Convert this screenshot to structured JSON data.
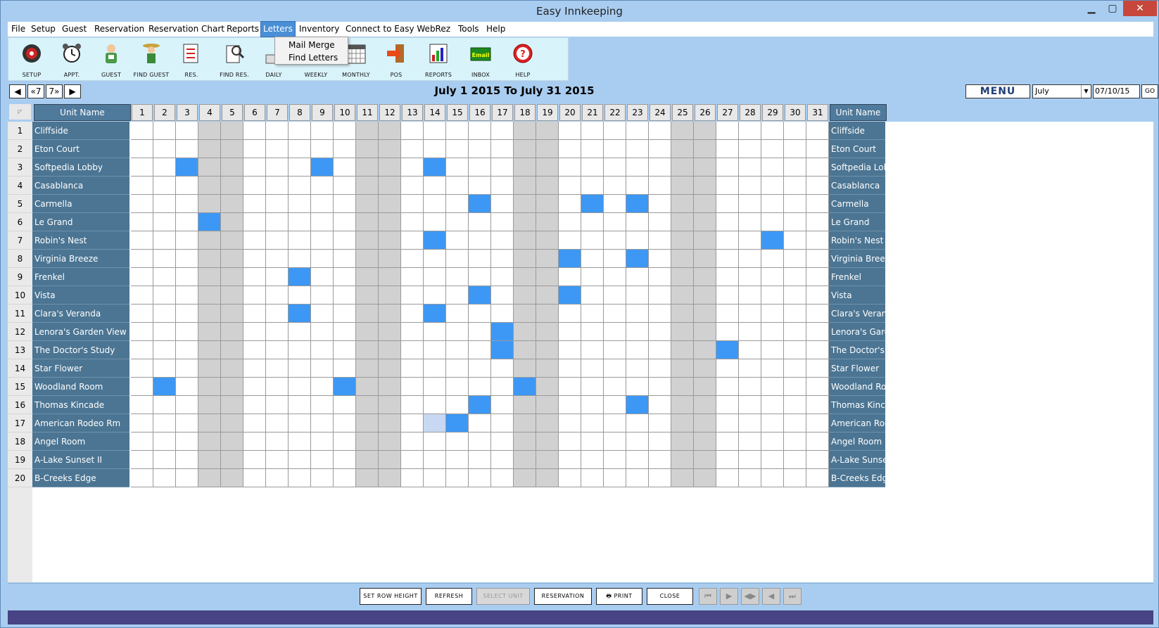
{
  "window": {
    "title": "Easy Innkeeping"
  },
  "menu": {
    "items": [
      "File",
      "Setup",
      "Guest",
      "Reservation",
      "Reservation Chart",
      "Reports",
      "Letters",
      "Inventory",
      "Connect to Easy WebRez",
      "Tools",
      "Help"
    ],
    "active": "Letters",
    "letters_dropdown": [
      "Mail Merge",
      "Find Letters"
    ]
  },
  "toolbar": {
    "buttons": [
      {
        "label": "SETUP",
        "icon": "setup-icon"
      },
      {
        "label": "APPT.",
        "icon": "alarm-clock-icon"
      },
      {
        "label": "GUEST",
        "icon": "guest-icon"
      },
      {
        "label": "FIND GUEST",
        "icon": "find-guest-icon"
      },
      {
        "label": "RES.",
        "icon": "reservation-icon"
      },
      {
        "label": "FIND RES.",
        "icon": "find-reservation-icon"
      },
      {
        "label": "DAILY",
        "icon": "daily-icon"
      },
      {
        "label": "WEEKLY",
        "icon": "weekly-icon"
      },
      {
        "label": "MONTHLY",
        "icon": "calendar-icon"
      },
      {
        "label": "POS",
        "icon": "pos-icon"
      },
      {
        "label": "REPORTS",
        "icon": "chart-icon"
      },
      {
        "label": "INBOX",
        "icon": "email-icon"
      },
      {
        "label": "HELP",
        "icon": "help-icon"
      }
    ]
  },
  "nav": {
    "prev_label": "◀",
    "back7_label": "«7",
    "fwd7_label": "7»",
    "next_label": "▶",
    "range_title": "July 1 2015  To  July 31 2015",
    "menu_label": "MENU",
    "month_value": "July",
    "date_value": "07/10/15",
    "go_label": "GO"
  },
  "grid": {
    "unit_name_header": "Unit Name",
    "days": [
      1,
      2,
      3,
      4,
      5,
      6,
      7,
      8,
      9,
      10,
      11,
      12,
      13,
      14,
      15,
      16,
      17,
      18,
      19,
      20,
      21,
      22,
      23,
      24,
      25,
      26,
      27,
      28,
      29,
      30,
      31
    ],
    "weekend_days": [
      4,
      5,
      11,
      12,
      18,
      19,
      25,
      26
    ],
    "units": [
      {
        "num": 1,
        "name": "Cliffside",
        "right_name": "Cliffside",
        "booked": []
      },
      {
        "num": 2,
        "name": "Eton Court",
        "right_name": "Eton Court",
        "booked": []
      },
      {
        "num": 3,
        "name": "Softpedia Lobby",
        "right_name": "Softpedia Lob",
        "booked": [
          3,
          9,
          14
        ]
      },
      {
        "num": 4,
        "name": "Casablanca",
        "right_name": "Casablanca",
        "booked": []
      },
      {
        "num": 5,
        "name": "Carmella",
        "right_name": "Carmella",
        "booked": [
          16,
          21,
          23
        ]
      },
      {
        "num": 6,
        "name": "Le Grand",
        "right_name": "Le Grand",
        "booked": [
          4
        ]
      },
      {
        "num": 7,
        "name": "Robin's Nest",
        "right_name": "Robin's Nest",
        "booked": [
          14,
          29
        ]
      },
      {
        "num": 8,
        "name": "Virginia Breeze",
        "right_name": "Virginia Breez",
        "booked": [
          20,
          23
        ]
      },
      {
        "num": 9,
        "name": "Frenkel",
        "right_name": "Frenkel",
        "booked": [
          8
        ]
      },
      {
        "num": 10,
        "name": "Vista",
        "right_name": "Vista",
        "booked": [
          16,
          20
        ]
      },
      {
        "num": 11,
        "name": "Clara's Veranda",
        "right_name": "Clara's Veran",
        "booked": [
          8,
          14
        ]
      },
      {
        "num": 12,
        "name": "Lenora's Garden View",
        "right_name": "Lenora's Garc",
        "booked": [
          17
        ]
      },
      {
        "num": 13,
        "name": "The Doctor's Study",
        "right_name": "The Doctor's",
        "booked": [
          17,
          27
        ]
      },
      {
        "num": 14,
        "name": "Star Flower",
        "right_name": "Star Flower",
        "booked": []
      },
      {
        "num": 15,
        "name": "Woodland Room",
        "right_name": "Woodland Ro",
        "booked": [
          2,
          10,
          18
        ]
      },
      {
        "num": 16,
        "name": "Thomas Kincade",
        "right_name": "Thomas Kinca",
        "booked": [
          16,
          23
        ]
      },
      {
        "num": 17,
        "name": "American Rodeo Rm",
        "right_name": "American Roc",
        "booked": [
          15
        ],
        "pending": [
          14
        ]
      },
      {
        "num": 18,
        "name": "Angel Room",
        "right_name": "Angel Room",
        "booked": []
      },
      {
        "num": 19,
        "name": "A-Lake Sunset II",
        "right_name": "A-Lake Sunse",
        "booked": []
      },
      {
        "num": 20,
        "name": "B-Creeks Edge",
        "right_name": "B-Creeks Edg",
        "booked": []
      }
    ]
  },
  "bottom": {
    "buttons": [
      "SET ROW HEIGHT",
      "REFRESH",
      "SELECT UNIT",
      "RESERVATION",
      "PRINT",
      "CLOSE"
    ],
    "disabled": [
      "SELECT UNIT"
    ],
    "nav_icons": [
      "⏮",
      "▶",
      "◀▶",
      "◀",
      "⏭"
    ]
  },
  "colors": {
    "booked": "#3d98f5",
    "weekend": "#d1d1d1",
    "unit_name_bg": "#4b7593",
    "status_bar": "#474384",
    "frame": "#a9cdf0"
  }
}
